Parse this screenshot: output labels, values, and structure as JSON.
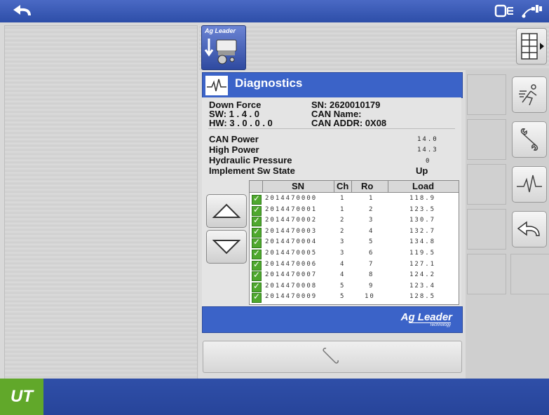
{
  "header": {
    "icons": [
      "back-arrow-icon",
      "display-link-icon",
      "gps-satellite-icon"
    ]
  },
  "implement_tab": {
    "brand": "Ag Leader",
    "icon": "planter-implement-icon"
  },
  "diagnostics": {
    "title": "Diagnostics",
    "module": "Down Force",
    "sw": "SW: 1 . 4 . 0",
    "hw": "HW: 3 . 0 . 0 . 0",
    "sn": "SN: 2620010179",
    "can_name": "CAN Name:",
    "can_addr": "CAN ADDR: 0X08",
    "metrics": [
      {
        "label": "CAN Power",
        "value": "14.0"
      },
      {
        "label": "High Power",
        "value": "14.3"
      },
      {
        "label": "Hydraulic Pressure",
        "value": "0"
      },
      {
        "label": "Implement Sw State",
        "value": "Up"
      }
    ],
    "table": {
      "headers": [
        "SN",
        "Ch",
        "Ro",
        "Load"
      ],
      "rows": [
        {
          "sn": "2014470000",
          "ch": "1",
          "ro": "1",
          "load": "118.9"
        },
        {
          "sn": "2014470001",
          "ch": "1",
          "ro": "2",
          "load": "123.5"
        },
        {
          "sn": "2014470002",
          "ch": "2",
          "ro": "3",
          "load": "130.7"
        },
        {
          "sn": "2014470003",
          "ch": "2",
          "ro": "4",
          "load": "132.7"
        },
        {
          "sn": "2014470004",
          "ch": "3",
          "ro": "5",
          "load": "134.8"
        },
        {
          "sn": "2014470005",
          "ch": "3",
          "ro": "6",
          "load": "119.5"
        },
        {
          "sn": "2014470006",
          "ch": "4",
          "ro": "7",
          "load": "127.1"
        },
        {
          "sn": "2014470007",
          "ch": "4",
          "ro": "8",
          "load": "124.2"
        },
        {
          "sn": "2014470008",
          "ch": "5",
          "ro": "9",
          "load": "123.4"
        },
        {
          "sn": "2014470009",
          "ch": "5",
          "ro": "10",
          "load": "128.5"
        }
      ]
    },
    "footer_brand": "Ag Leader",
    "footer_sub": "Technology"
  },
  "bottom": {
    "logo": "UT"
  },
  "colors": {
    "blue_bar": "#3b63c8",
    "green_logo": "#61a82a",
    "check_green": "#4fa82e"
  }
}
